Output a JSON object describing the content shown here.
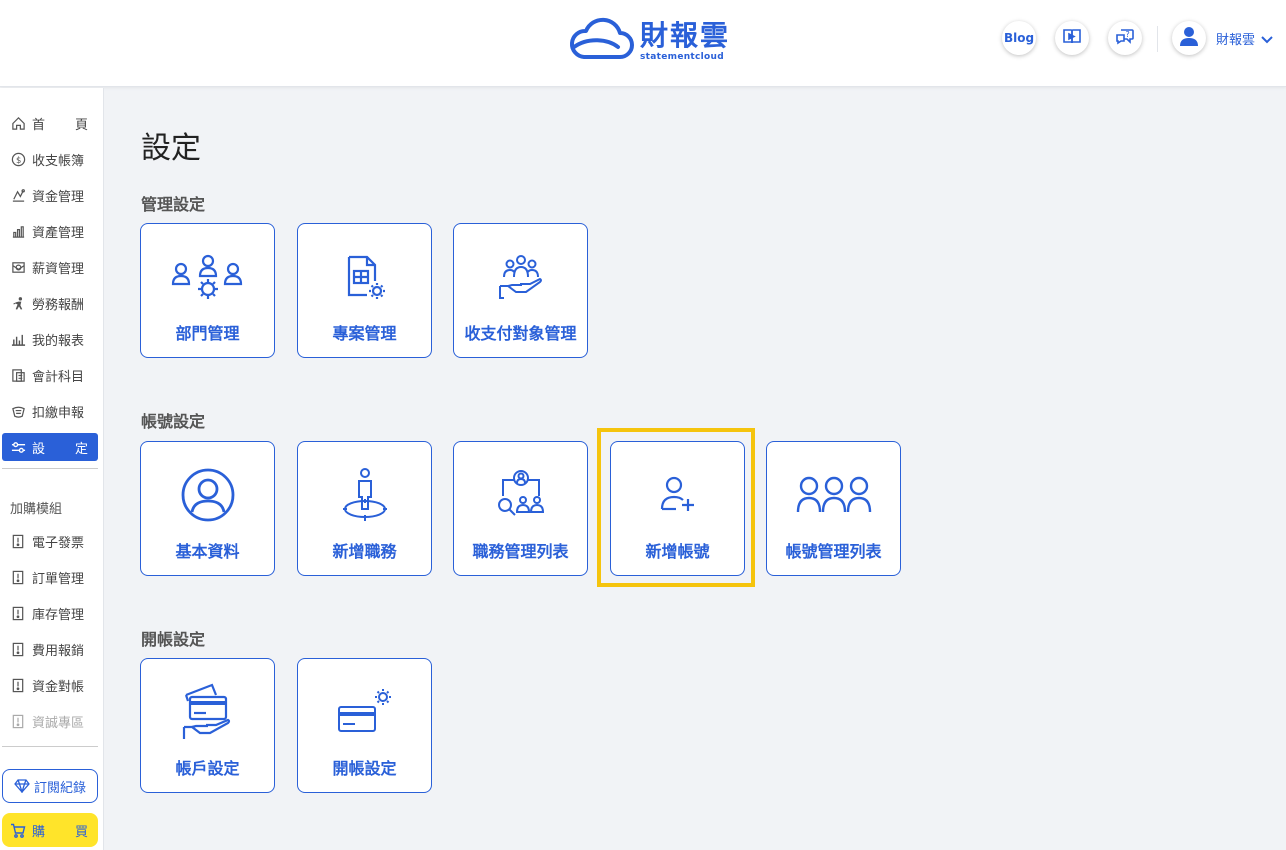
{
  "header": {
    "logo_cn": "財報雲",
    "logo_en": "statementcloud",
    "blog_label": "Blog",
    "user_name": "財報雲"
  },
  "sidebar": {
    "items": [
      {
        "label_a": "首",
        "label_b": "頁",
        "icon": "home-icon"
      },
      {
        "label": "收支帳簿",
        "icon": "coin-icon"
      },
      {
        "label": "資金管理",
        "icon": "funds-icon"
      },
      {
        "label": "資產管理",
        "icon": "assets-icon"
      },
      {
        "label": "薪資管理",
        "icon": "salary-icon"
      },
      {
        "label": "勞務報酬",
        "icon": "labor-icon"
      },
      {
        "label": "我的報表",
        "icon": "report-icon"
      },
      {
        "label": "會計科目",
        "icon": "ledger-icon"
      },
      {
        "label": "扣繳申報",
        "icon": "withholding-icon"
      },
      {
        "label_a": "設",
        "label_b": "定",
        "icon": "settings-sliders-icon",
        "active": true
      }
    ],
    "addon_title": "加購模組",
    "addons": [
      {
        "label": "電子發票",
        "icon": "module-icon"
      },
      {
        "label": "訂單管理",
        "icon": "module-icon"
      },
      {
        "label": "庫存管理",
        "icon": "module-icon"
      },
      {
        "label": "費用報銷",
        "icon": "module-icon"
      },
      {
        "label": "資金對帳",
        "icon": "module-icon"
      },
      {
        "label": "資誠專區",
        "icon": "module-icon",
        "disabled": true
      }
    ],
    "subscription_label": "訂閱紀錄",
    "buy_label_a": "購",
    "buy_label_b": "買"
  },
  "main": {
    "title": "設定",
    "sections": [
      {
        "title": "管理設定",
        "cards": [
          {
            "label": "部門管理",
            "icon": "department-icon"
          },
          {
            "label": "專案管理",
            "icon": "project-icon"
          },
          {
            "label": "收支付對象管理",
            "icon": "payee-icon"
          }
        ]
      },
      {
        "title": "帳號設定",
        "cards": [
          {
            "label": "基本資料",
            "icon": "profile-icon"
          },
          {
            "label": "新增職務",
            "icon": "add-role-icon"
          },
          {
            "label": "職務管理列表",
            "icon": "role-list-icon"
          },
          {
            "label": "新增帳號",
            "icon": "add-user-icon"
          },
          {
            "label": "帳號管理列表",
            "icon": "user-list-icon"
          }
        ]
      },
      {
        "title": "開帳設定",
        "cards": [
          {
            "label": "帳戶設定",
            "icon": "account-card-icon"
          },
          {
            "label": "開帳設定",
            "icon": "opening-card-icon"
          }
        ]
      }
    ]
  },
  "colors": {
    "brand": "#2a60d8",
    "highlight": "#f5c40d",
    "buy": "#ffe42a"
  }
}
